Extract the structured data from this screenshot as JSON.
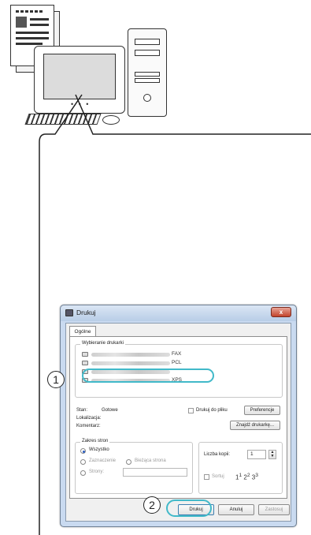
{
  "dialog": {
    "title": "Drukuj",
    "close_label": "x",
    "tab_label": "Ogólne",
    "select_printer": {
      "group_label": "Wybieranie drukarki",
      "printers": [
        {
          "name": "FAX"
        },
        {
          "name": "PCL"
        },
        {
          "name": ""
        },
        {
          "name": "XPS"
        }
      ]
    },
    "status": {
      "state_label": "Stan:",
      "state_value": "Gotowe",
      "location_label": "Lokalizacja:",
      "comment_label": "Komentarz:",
      "print_to_file_label": "Drukuj do pliku",
      "preferences_button": "Preferencje",
      "find_printer_button": "Znajdź drukarkę..."
    },
    "page_range": {
      "group_label": "Zakres stron",
      "all_label": "Wszystko",
      "selection_label": "Zaznaczenie",
      "current_page_label": "Bieżąca strona",
      "pages_label": "Strony:",
      "pages_value": ""
    },
    "copies": {
      "number_label": "Liczba kopii:",
      "number_value": "1",
      "collate_label": "Sortuj"
    },
    "buttons": {
      "print": "Drukuj",
      "cancel": "Anuluj",
      "apply": "Zastosuj"
    }
  },
  "callouts": {
    "step1": "1",
    "step2": "2",
    "highlight_color": "#41b9c9"
  }
}
